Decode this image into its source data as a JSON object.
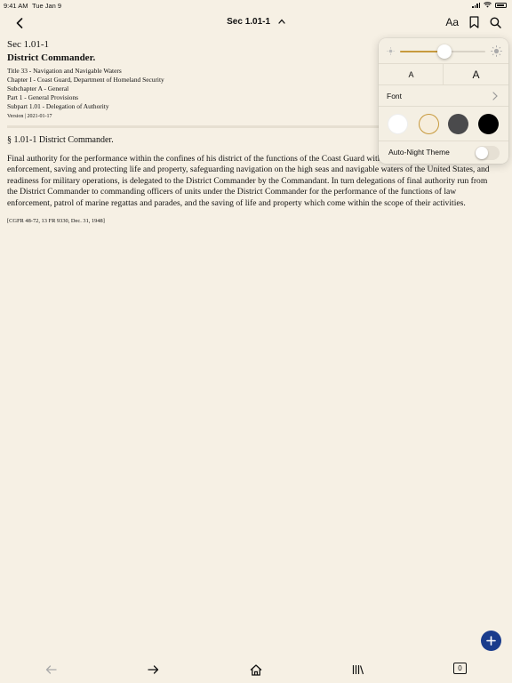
{
  "status_bar": {
    "time": "9:41 AM",
    "date": "Tue Jan 9"
  },
  "nav": {
    "title": "Sec 1.01-1",
    "font_button_label": "Aa",
    "icons": [
      "back-chevron-icon",
      "chevron-up-icon",
      "bookmark-icon",
      "search-icon"
    ]
  },
  "document": {
    "section_number": "Sec 1.01-1",
    "heading": "District Commander.",
    "hierarchy": [
      "Title 33 - Navigation and Navigable Waters",
      "Chapter I - Coast Guard, Department of Homeland Security",
      "Subchapter A - General",
      "Part 1 - General Provisions",
      "Subpart 1.01 - Delegation of Authority"
    ],
    "version": "Version | 2021-01-17",
    "section_title": "§ 1.01-1 District Commander.",
    "body": "Final authority for the performance within the confines of his district of the functions of the Coast Guard with respect to maritime law enforcement, saving and protecting life and property, safeguarding navigation on the high seas and navigable waters of the United States, and readiness for military operations, is delegated to the District Commander by the Commandant. In turn delegations of final authority run from the District Commander to commanding officers of units under the District Commander for the performance of the functions of law enforcement, patrol of marine regattas and parades, and the saving of life and property which come within the scope of their activities.",
    "citation": "[CGFR 48-72, 13 FR 9330, Dec. 31, 1948]"
  },
  "reader_settings": {
    "brightness": 0.52,
    "font_size_smaller_label": "A",
    "font_size_larger_label": "A",
    "font_label": "Font",
    "themes": [
      {
        "name": "white",
        "color": "#ffffff",
        "selected": false
      },
      {
        "name": "sepia",
        "color": "#f6eddc",
        "selected": true
      },
      {
        "name": "gray",
        "color": "#4a4a4c",
        "selected": false
      },
      {
        "name": "black",
        "color": "#000000",
        "selected": false
      }
    ],
    "auto_night_label": "Auto-Night Theme",
    "auto_night_enabled": false
  },
  "toolbar": {
    "tab_count": "0",
    "icons": [
      "back-arrow-icon",
      "forward-arrow-icon",
      "home-icon",
      "library-icon"
    ]
  },
  "colors": {
    "background": "#f6f0e4",
    "accent": "#c79a3e",
    "fab": "#1a3c8c"
  }
}
